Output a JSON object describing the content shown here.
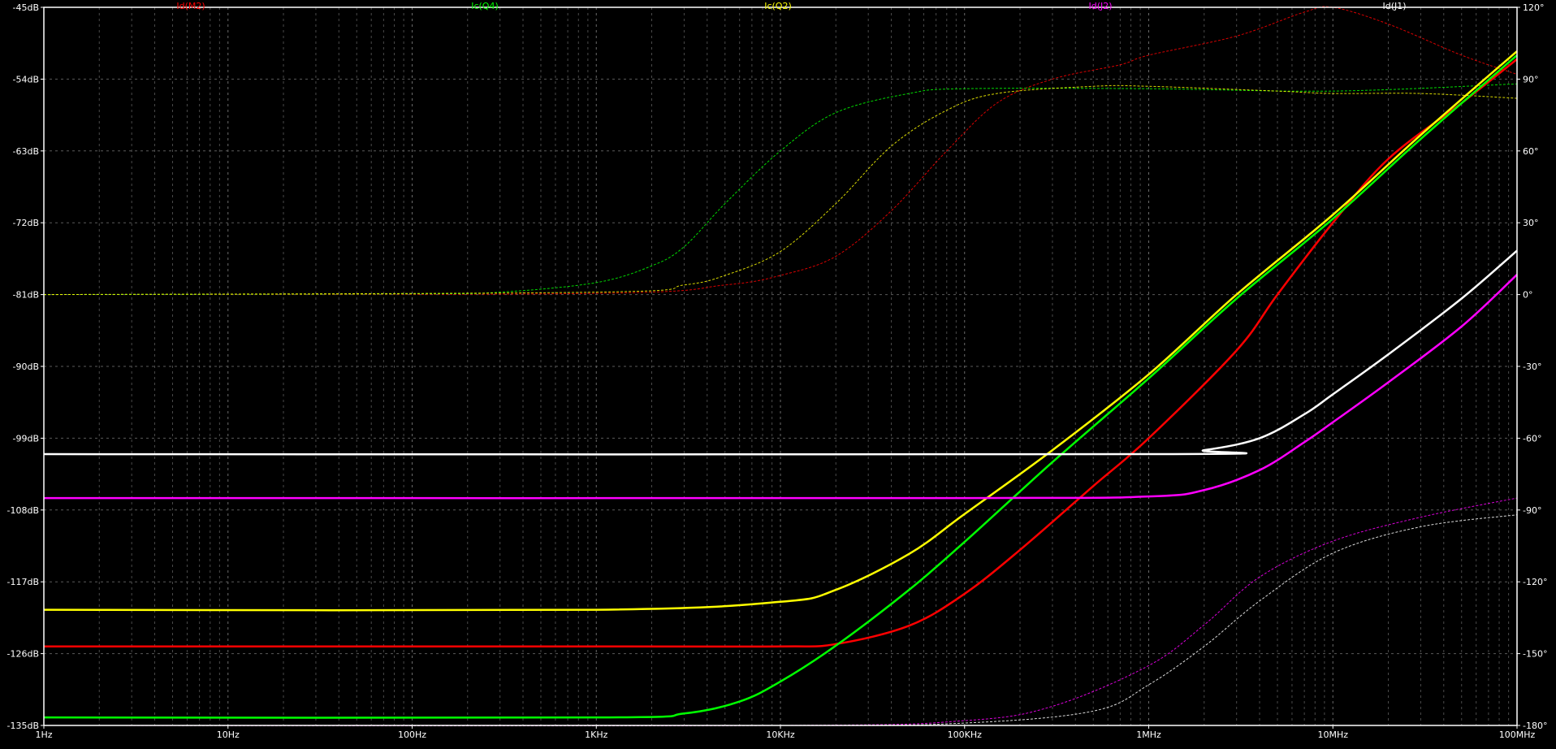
{
  "chart_data": {
    "type": "line",
    "x_scale": "log",
    "xlim": [
      1,
      100000000
    ],
    "x_ticks": [
      {
        "value": 1,
        "label": "1Hz"
      },
      {
        "value": 10,
        "label": "10Hz"
      },
      {
        "value": 100,
        "label": "100Hz"
      },
      {
        "value": 1000,
        "label": "1KHz"
      },
      {
        "value": 10000,
        "label": "10KHz"
      },
      {
        "value": 100000,
        "label": "100KHz"
      },
      {
        "value": 1000000,
        "label": "1MHz"
      },
      {
        "value": 10000000,
        "label": "10MHz"
      },
      {
        "value": 100000000,
        "label": "100MHz"
      }
    ],
    "ylim_left": [
      -135,
      -45
    ],
    "y_left_ticks": [
      {
        "value": -45,
        "label": "-45dB"
      },
      {
        "value": -54,
        "label": "-54dB"
      },
      {
        "value": -63,
        "label": "-63dB"
      },
      {
        "value": -72,
        "label": "-72dB"
      },
      {
        "value": -81,
        "label": "-81dB"
      },
      {
        "value": -90,
        "label": "-90dB"
      },
      {
        "value": -99,
        "label": "-99dB"
      },
      {
        "value": -108,
        "label": "-108dB"
      },
      {
        "value": -117,
        "label": "-117dB"
      },
      {
        "value": -126,
        "label": "-126dB"
      },
      {
        "value": -135,
        "label": "-135dB"
      }
    ],
    "ylim_right": [
      -180,
      120
    ],
    "y_right_ticks": [
      {
        "value": 120,
        "label": "120°"
      },
      {
        "value": 90,
        "label": "90°"
      },
      {
        "value": 60,
        "label": "60°"
      },
      {
        "value": 30,
        "label": "30°"
      },
      {
        "value": 0,
        "label": "0°"
      },
      {
        "value": -30,
        "label": "-30°"
      },
      {
        "value": -60,
        "label": "-60°"
      },
      {
        "value": -90,
        "label": "-90°"
      },
      {
        "value": -120,
        "label": "-120°"
      },
      {
        "value": -150,
        "label": "-150°"
      },
      {
        "value": -180,
        "label": "-180°"
      }
    ],
    "grid": true,
    "legend_position": "top",
    "series": [
      {
        "name": "Id(M2)",
        "color": "#ff0000",
        "magnitude": [
          [
            1,
            -125.1
          ],
          [
            1000,
            -125.1
          ],
          [
            10000,
            -125.1
          ],
          [
            20000,
            -124.8
          ],
          [
            50000,
            -122.5
          ],
          [
            100000,
            -118.5
          ],
          [
            200000,
            -113
          ],
          [
            500000,
            -105
          ],
          [
            1000000,
            -99
          ],
          [
            3000000,
            -88
          ],
          [
            5000000,
            -81
          ],
          [
            10000000,
            -72
          ],
          [
            20000000,
            -64
          ],
          [
            50000000,
            -57
          ],
          [
            100000000,
            -51.5
          ]
        ],
        "phase": [
          [
            1,
            0
          ],
          [
            1000,
            0.5
          ],
          [
            5000,
            4
          ],
          [
            10000,
            8
          ],
          [
            20000,
            16
          ],
          [
            40000,
            35
          ],
          [
            80000,
            60
          ],
          [
            150000,
            80
          ],
          [
            300000,
            90
          ],
          [
            700000,
            96
          ],
          [
            1000000,
            100
          ],
          [
            3000000,
            108
          ],
          [
            7000000,
            118
          ],
          [
            10000000,
            120
          ],
          [
            20000000,
            113
          ],
          [
            50000000,
            100
          ],
          [
            100000000,
            92
          ]
        ]
      },
      {
        "name": "Ic(Q4)",
        "color": "#00ff00",
        "magnitude": [
          [
            1,
            -134
          ],
          [
            1000,
            -134
          ],
          [
            3000,
            -133.5
          ],
          [
            6000,
            -132
          ],
          [
            10000,
            -129.5
          ],
          [
            20000,
            -125
          ],
          [
            50000,
            -118
          ],
          [
            100000,
            -112
          ],
          [
            300000,
            -102
          ],
          [
            1000000,
            -91.5
          ],
          [
            3000000,
            -81.5
          ],
          [
            10000000,
            -71.5
          ],
          [
            30000000,
            -61.5
          ],
          [
            100000000,
            -51
          ]
        ],
        "phase": [
          [
            1,
            0
          ],
          [
            100,
            0.3
          ],
          [
            300,
            1
          ],
          [
            1000,
            5
          ],
          [
            2000,
            12
          ],
          [
            3000,
            20
          ],
          [
            5000,
            38
          ],
          [
            10000,
            60
          ],
          [
            20000,
            76
          ],
          [
            50000,
            84
          ],
          [
            100000,
            86
          ],
          [
            1000000,
            86
          ],
          [
            10000000,
            85
          ],
          [
            100000000,
            88
          ]
        ]
      },
      {
        "name": "Ic(Q2)",
        "color": "#ffff00",
        "magnitude": [
          [
            1,
            -120.5
          ],
          [
            1000,
            -120.5
          ],
          [
            10000,
            -119.5
          ],
          [
            20000,
            -118
          ],
          [
            50000,
            -113.5
          ],
          [
            100000,
            -108.5
          ],
          [
            300000,
            -100.5
          ],
          [
            1000000,
            -91
          ],
          [
            3000000,
            -81
          ],
          [
            10000000,
            -71
          ],
          [
            30000000,
            -61
          ],
          [
            100000000,
            -50.5
          ]
        ],
        "phase": [
          [
            1,
            0
          ],
          [
            1000,
            1
          ],
          [
            3000,
            4
          ],
          [
            5000,
            8
          ],
          [
            10000,
            18
          ],
          [
            20000,
            38
          ],
          [
            40000,
            62
          ],
          [
            80000,
            77
          ],
          [
            150000,
            84
          ],
          [
            500000,
            87
          ],
          [
            1000000,
            87
          ],
          [
            5000000,
            85
          ],
          [
            10000000,
            84
          ],
          [
            30000000,
            84
          ],
          [
            100000000,
            82
          ]
        ]
      },
      {
        "name": "Id(J2)",
        "color": "#ff00ff",
        "magnitude": [
          [
            1,
            -106.5
          ],
          [
            100000,
            -106.5
          ],
          [
            1000000,
            -106.3
          ],
          [
            2000000,
            -105.5
          ],
          [
            4000000,
            -103
          ],
          [
            7000000,
            -99.5
          ],
          [
            10000000,
            -97
          ],
          [
            20000000,
            -92
          ],
          [
            50000000,
            -85
          ],
          [
            100000000,
            -78.5
          ]
        ],
        "phase": [
          [
            1,
            -180
          ],
          [
            10000,
            -180
          ],
          [
            100000,
            -178
          ],
          [
            300000,
            -172
          ],
          [
            1000000,
            -155
          ],
          [
            2000000,
            -138
          ],
          [
            4000000,
            -118
          ],
          [
            10000000,
            -103
          ],
          [
            30000000,
            -93
          ],
          [
            100000000,
            -85
          ]
        ]
      },
      {
        "name": "Id(J1)",
        "color": "#ffffff",
        "magnitude": [
          [
            1,
            -101
          ],
          [
            1000000,
            -101
          ],
          [
            2000000,
            -100.5
          ],
          [
            4000000,
            -99
          ],
          [
            7000000,
            -96
          ],
          [
            10000000,
            -93.5
          ],
          [
            20000000,
            -88.5
          ],
          [
            50000000,
            -81.5
          ],
          [
            100000000,
            -75.5
          ]
        ],
        "phase": [
          [
            1,
            -180
          ],
          [
            10000,
            -180
          ],
          [
            100000,
            -179
          ],
          [
            500000,
            -174
          ],
          [
            1000000,
            -163
          ],
          [
            2000000,
            -147
          ],
          [
            4000000,
            -128
          ],
          [
            10000000,
            -108
          ],
          [
            30000000,
            -97
          ],
          [
            100000000,
            -92
          ]
        ]
      }
    ]
  }
}
